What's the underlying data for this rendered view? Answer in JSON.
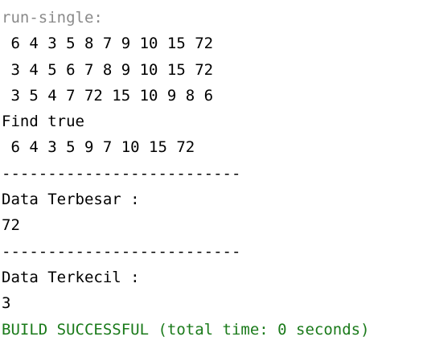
{
  "console": {
    "colors": {
      "background": "#ffffff",
      "text": "#000000",
      "muted": "#8a8a8a",
      "success": "#1a7a1a"
    },
    "lines": [
      {
        "text": "run-single:",
        "style": "muted"
      },
      {
        "text": " 6 4 3 5 8 7 9 10 15 72",
        "style": "normal"
      },
      {
        "text": " 3 4 5 6 7 8 9 10 15 72",
        "style": "normal"
      },
      {
        "text": " 3 5 4 7 72 15 10 9 8 6",
        "style": "normal"
      },
      {
        "text": "Find true",
        "style": "normal"
      },
      {
        "text": " 6 4 3 5 9 7 10 15 72",
        "style": "normal"
      },
      {
        "text": "--------------------------",
        "style": "normal"
      },
      {
        "text": "Data Terbesar :",
        "style": "normal"
      },
      {
        "text": "72",
        "style": "normal"
      },
      {
        "text": "--------------------------",
        "style": "normal"
      },
      {
        "text": "Data Terkecil :",
        "style": "normal"
      },
      {
        "text": "3",
        "style": "normal"
      },
      {
        "text": "BUILD SUCCESSFUL (total time: 0 seconds)",
        "style": "success"
      }
    ]
  }
}
